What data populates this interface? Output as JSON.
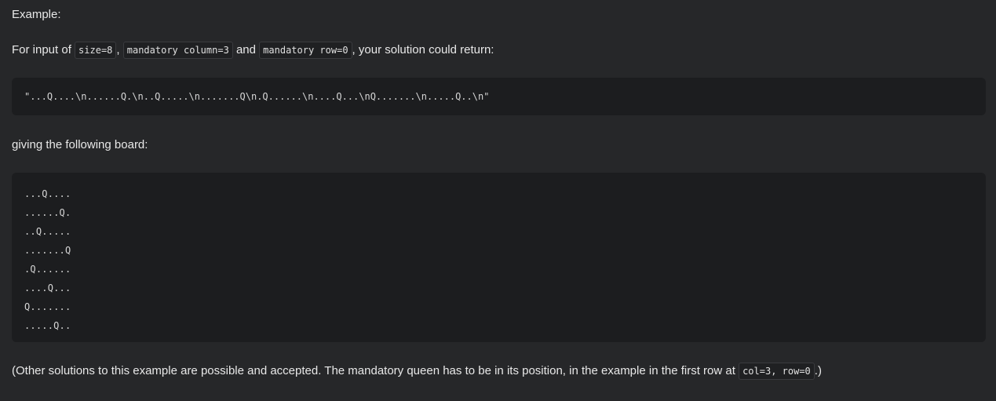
{
  "heading": "Example:",
  "intro": {
    "prefix": "For input of ",
    "code1": "size=8",
    "sep1": ",",
    "code2": "mandatory column=3",
    "middle": " and ",
    "code3": "mandatory row=0",
    "suffix": ", your solution could return:"
  },
  "solution_string": "\"...Q....\\n......Q.\\n..Q.....\\n.......Q\\n.Q......\\n....Q...\\nQ.......\\n.....Q..\\n\"",
  "board_intro": "giving the following board:",
  "board": [
    "...Q....",
    "......Q.",
    "..Q.....",
    ".......Q",
    ".Q......",
    "....Q...",
    "Q.......",
    ".....Q.."
  ],
  "note": {
    "prefix": "(Other solutions to this example are possible and accepted. The mandatory queen has to be in its position, in the example in the first row at ",
    "code": "col=3, row=0",
    "suffix": ".)"
  }
}
